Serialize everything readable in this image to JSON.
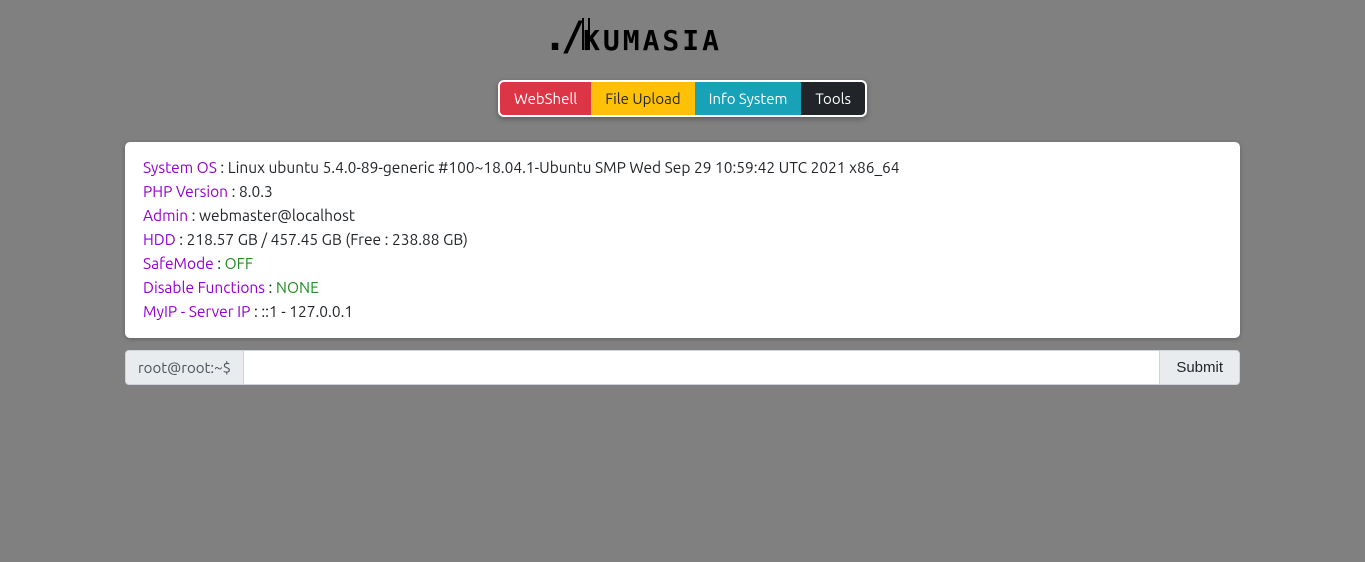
{
  "header": {
    "logo_text": "./kumasia"
  },
  "nav": {
    "webshell": "WebShell",
    "file_upload": "File Upload",
    "info_system": "Info System",
    "tools": "Tools"
  },
  "info": {
    "system_os_label": "System OS",
    "system_os_value": " : Linux ubuntu 5.4.0-89-generic #100~18.04.1-Ubuntu SMP Wed Sep 29 10:59:42 UTC 2021 x86_64",
    "php_version_label": "PHP Version",
    "php_version_value": " : 8.0.3",
    "admin_label": "Admin",
    "admin_value": " : webmaster@localhost",
    "hdd_label": "HDD",
    "hdd_value": " : 218.57 GB / 457.45 GB (Free : 238.88 GB)",
    "safemode_label": "SafeMode",
    "safemode_colon": " : ",
    "safemode_value": "OFF",
    "disable_functions_label": "Disable Functions",
    "disable_functions_colon": " : ",
    "disable_functions_value": "NONE",
    "myip_label": "MyIP - Server IP",
    "myip_value": " : ::1 - 127.0.0.1"
  },
  "command": {
    "prompt": "root@root:~$",
    "input_value": "",
    "submit_label": "Submit"
  }
}
